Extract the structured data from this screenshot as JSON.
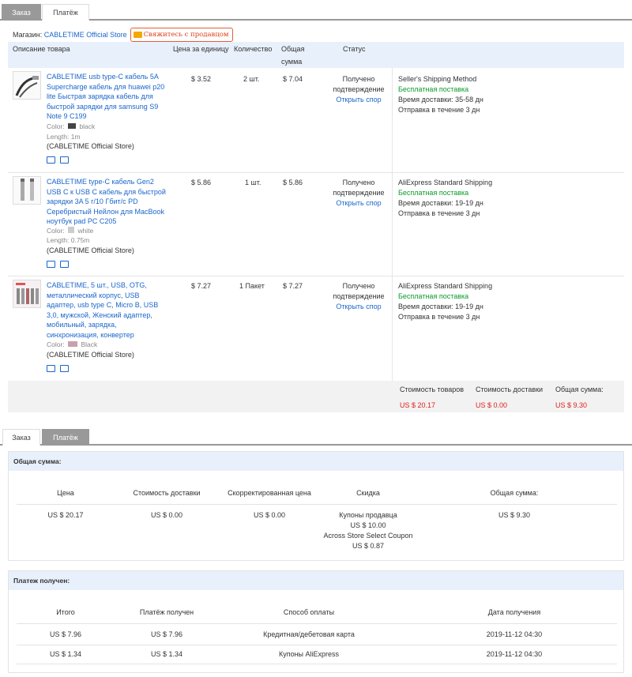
{
  "top_tabs": {
    "order": "Заказ",
    "payment": "Платёж"
  },
  "store": {
    "label": "Магазин:",
    "name": "CABLETIME Official Store",
    "contact": "Свяжитесь с продавцом"
  },
  "order_table": {
    "headers": {
      "description": "Описание товара",
      "unit_price": "Цена за единицу",
      "quantity": "Количество",
      "total_line1": "Общая",
      "total_line2": "сумма",
      "status": "Статус"
    },
    "items": [
      {
        "name_lines": [
          "CABLETIME usb type-C кабель 5A",
          "Supercharge кабель для huawei p20",
          "lite Быстрая зарядка кабель для",
          "быстрой зарядки для samsung S9",
          "Note 9 C199"
        ],
        "color_label": "Color:",
        "color": "black",
        "length_label": "Length:",
        "length": "1m",
        "store": "(CABLETIME Official Store)",
        "price": "$ 3.52",
        "qty": "2 шт.",
        "total": "$ 7.04",
        "status_line1": "Получено",
        "status_line2": "подтверждение",
        "dispute": "Открыть спор",
        "shipping_method": "Seller's Shipping Method",
        "free_shipping": "Бесплатная поставка",
        "delivery_time": "Время доставки: 35-58 дн",
        "dispatch": "Отправка в течение 3 дн"
      },
      {
        "name_lines": [
          "CABLETIME type-C кабель Gen2",
          "USB C к USB C кабель для быстрой",
          "зарядки 3A 5 г/10 Гбит/с PD",
          "Серебристый Нейлон для MacBook",
          "ноутбук pad PC C205"
        ],
        "color_label": "Color:",
        "color": "white",
        "length_label": "Length:",
        "length": "0.75m",
        "store": "(CABLETIME Official Store)",
        "price": "$ 5.86",
        "qty": "1 шт.",
        "total": "$ 5.86",
        "status_line1": "Получено",
        "status_line2": "подтверждение",
        "dispute": "Открыть спор",
        "shipping_method": "AliExpress Standard Shipping",
        "free_shipping": "Бесплатная поставка",
        "delivery_time": "Время доставки: 19-19 дн",
        "dispatch": "Отправка в течение 3 дн"
      },
      {
        "name_lines": [
          "CABLETIME, 5 шт., USB, OTG,",
          "металлический корпус, USB",
          "адаптер, usb type C, Micro B, USB",
          "3,0, мужской, Женский адаптер,",
          "мобильный, зарядка,",
          "синхронизация, конвертер"
        ],
        "color_label": "Color:",
        "color": "Black",
        "store": "(CABLETIME Official Store)",
        "price": "$ 7.27",
        "qty": "1 Пакет",
        "total": "$ 7.27",
        "status_line1": "Получено",
        "status_line2": "подтверждение",
        "dispute": "Открыть спор",
        "shipping_method": "AliExpress Standard Shipping",
        "free_shipping": "Бесплатная поставка",
        "delivery_time": "Время доставки: 19-19 дн",
        "dispatch": "Отправка в течение 3 дн"
      }
    ],
    "summary": {
      "goods_label": "Стоимость товаров",
      "goods_value": "US $ 20.17",
      "shipping_label": "Стоимость доставки",
      "shipping_value": "US $ 0.00",
      "total_label": "Общая сумма:",
      "total_value": "US $ 9.30"
    }
  },
  "bottom_tabs": {
    "order": "Заказ",
    "payment": "Платёж"
  },
  "total_panel": {
    "title": "Общая сумма:",
    "headers": {
      "price": "Цена",
      "shipping": "Стоимость доставки",
      "adjusted": "Скорректированная цена",
      "discount": "Скидка",
      "total": "Общая сумма:"
    },
    "values": {
      "price": "US $ 20.17",
      "shipping": "US $ 0.00",
      "adjusted": "US $ 0.00",
      "discount_line1": "Купоны продавца",
      "discount_line2": "US $ 10.00",
      "discount_line3": "Across Store Select Coupon",
      "discount_line4": "US $ 0.87",
      "total": "US $ 9.30"
    }
  },
  "payment_panel": {
    "title": "Платеж получен:",
    "headers": {
      "total": "Итого",
      "received": "Платёж получен",
      "method": "Способ оплаты",
      "date": "Дата получения"
    },
    "rows": [
      {
        "total": "US $ 7.96",
        "received": "US $ 7.96",
        "method": "Кредитная/дебетовая карта",
        "date": "2019-11-12 04:30"
      },
      {
        "total": "US $ 1.34",
        "received": "US $ 1.34",
        "method": "Купоны AliExpress",
        "date": "2019-11-12 04:30"
      }
    ]
  },
  "colors": {
    "link": "#1a66cc",
    "free_shipping": "#0a9a2a",
    "price_red": "#e0201c",
    "header_bg": "#e8f0fb",
    "active_tab": "#999999"
  }
}
